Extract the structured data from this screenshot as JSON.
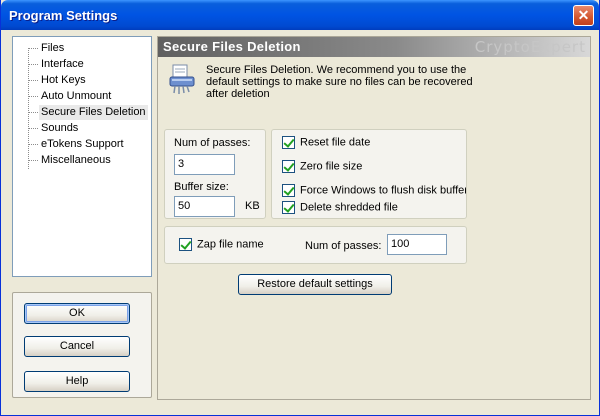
{
  "window": {
    "title": "Program Settings"
  },
  "tree": {
    "items": [
      {
        "label": "Files",
        "selected": false
      },
      {
        "label": "Interface",
        "selected": false
      },
      {
        "label": "Hot Keys",
        "selected": false
      },
      {
        "label": "Auto Unmount",
        "selected": false
      },
      {
        "label": "Secure Files Deletion",
        "selected": true
      },
      {
        "label": "Sounds",
        "selected": false
      },
      {
        "label": "eTokens Support",
        "selected": false
      },
      {
        "label": "Miscellaneous",
        "selected": false
      }
    ]
  },
  "buttons": {
    "ok": "OK",
    "cancel": "Cancel",
    "help": "Help"
  },
  "panel": {
    "title": "Secure Files Deletion",
    "brand": "CryptoExpert",
    "description": "Secure Files Deletion. We recommend you to use the default settings to make sure no files can be recovered after deletion"
  },
  "passes": {
    "label": "Num of passes:",
    "value": "3"
  },
  "buffer": {
    "label": "Buffer size:",
    "value": "50",
    "unit": "KB"
  },
  "options": [
    {
      "label": "Reset file date",
      "checked": true
    },
    {
      "label": "Zero file size",
      "checked": true
    },
    {
      "label": "Force Windows to flush disk buffers",
      "checked": true
    },
    {
      "label": "Delete shredded file",
      "checked": true
    }
  ],
  "zap": {
    "label": "Zap file name",
    "checked": true,
    "passes_label": "Num of passes:",
    "passes_value": "100"
  },
  "restore_button": "Restore default settings"
}
